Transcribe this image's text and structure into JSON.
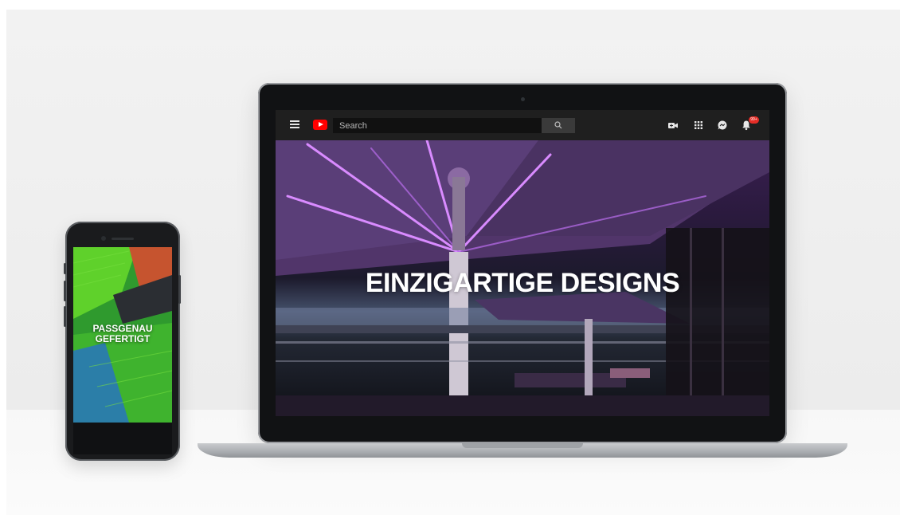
{
  "youtube": {
    "search_placeholder": "Search",
    "notification_count": "99+",
    "video_title": "EINZIGARTIGE DESIGNS"
  },
  "phone": {
    "overlay_line1": "PASSGENAU",
    "overlay_line2": "GEFERTIGT"
  },
  "icons": {
    "menu": "hamburger-menu-icon",
    "logo": "youtube-logo-icon",
    "search": "magnifier-icon",
    "create": "video-camera-plus-icon",
    "apps": "apps-grid-icon",
    "messages": "chat-bubble-icon",
    "notifications": "bell-icon"
  },
  "colors": {
    "youtube_red": "#ff0000",
    "badge_red": "#e52d27",
    "topbar": "#1f1f1f",
    "neon_purple": "#c46cff",
    "fabric_green": "#5fd12b"
  }
}
